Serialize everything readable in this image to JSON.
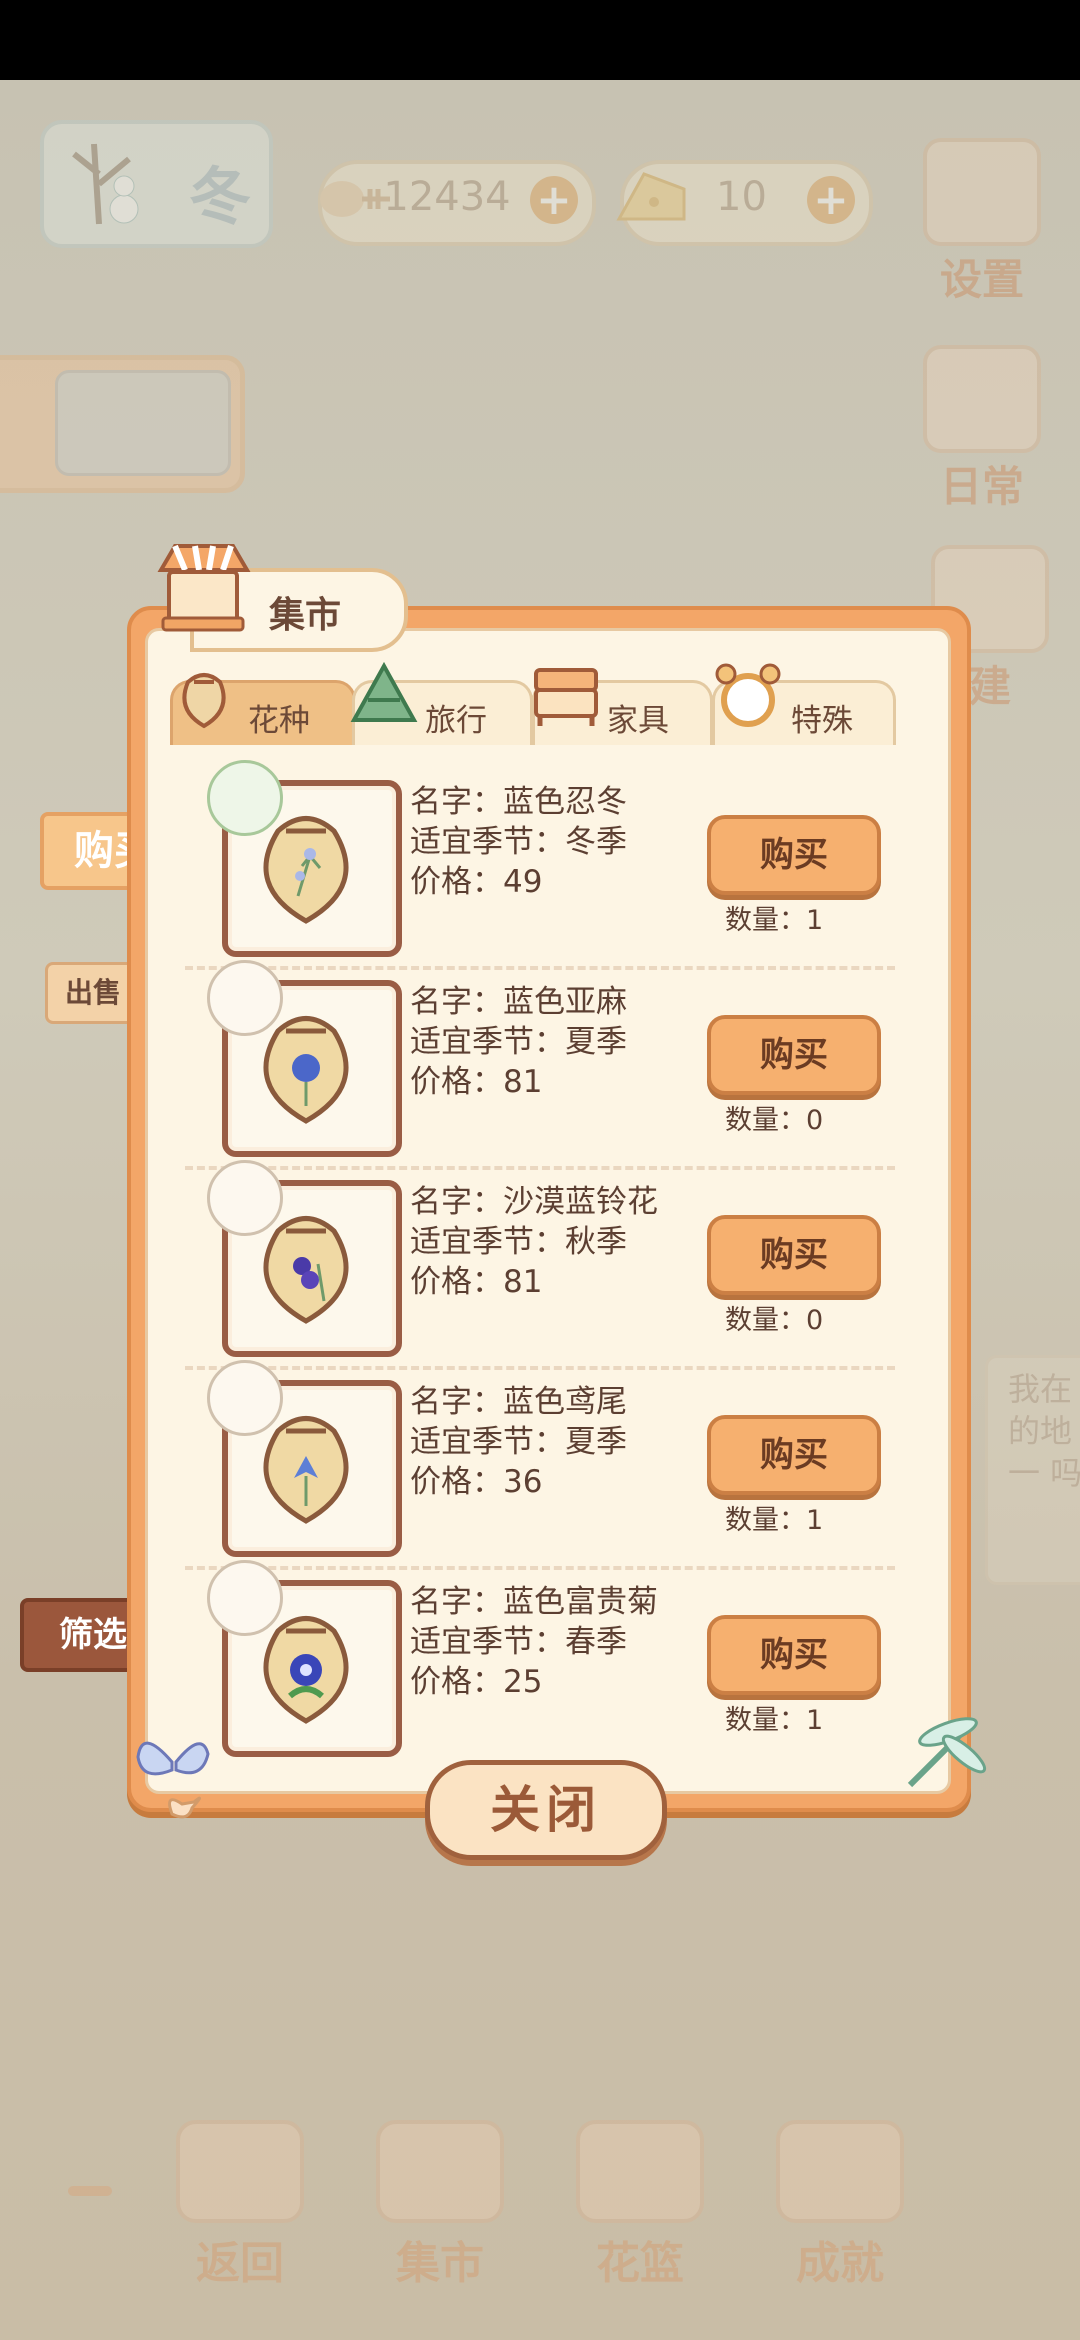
{
  "hud": {
    "season": "冬",
    "fish_count": "12434",
    "cheese_count": "10",
    "settings_label": "设置",
    "daily_label": "日常",
    "build_label": "建"
  },
  "side": {
    "buy_label": "购买",
    "sell_label": "出售",
    "filter_label": "筛选"
  },
  "market": {
    "title": "集市",
    "tabs": [
      {
        "label": "花种"
      },
      {
        "label": "旅行"
      },
      {
        "label": "家具"
      },
      {
        "label": "特殊"
      }
    ],
    "items": [
      {
        "name": "名字：蓝色忍冬",
        "season": "适宜季节：冬季",
        "price": "价格：49",
        "buy": "购买",
        "qty": "数量：1"
      },
      {
        "name": "名字：蓝色亚麻",
        "season": "适宜季节：夏季",
        "price": "价格：81",
        "buy": "购买",
        "qty": "数量：0"
      },
      {
        "name": "名字：沙漠蓝铃花",
        "season": "适宜季节：秋季",
        "price": "价格：81",
        "buy": "购买",
        "qty": "数量：0"
      },
      {
        "name": "名字：蓝色鸢尾",
        "season": "适宜季节：夏季",
        "price": "价格：36",
        "buy": "购买",
        "qty": "数量：1"
      },
      {
        "name": "名字：蓝色富贵菊",
        "season": "适宜季节：春季",
        "price": "价格：25",
        "buy": "购买",
        "qty": "数量：1"
      }
    ],
    "close_label": "关闭"
  },
  "background_text": {
    "notice": "我在 的地 一 吗"
  },
  "bottom_nav": [
    {
      "label": "返回"
    },
    {
      "label": "集市"
    },
    {
      "label": "花篮"
    },
    {
      "label": "成就"
    }
  ],
  "colors": {
    "panel_orange": "#f3a668",
    "panel_cream": "#fdf5e4",
    "button_orange": "#f6b06f",
    "text_brown": "#5c3f32"
  }
}
